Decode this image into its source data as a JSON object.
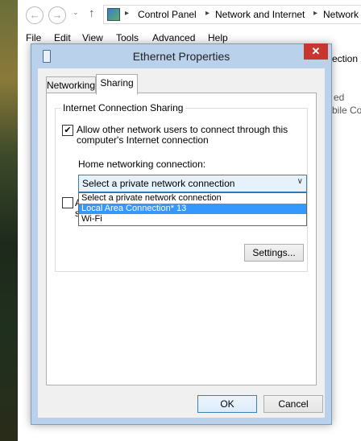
{
  "explorer": {
    "nav": {
      "back_icon": "←",
      "forward_icon": "→",
      "up_icon": "↑",
      "dropdown_icon": "⌄"
    },
    "breadcrumb": [
      "Control Panel",
      "Network and Internet",
      "Network"
    ],
    "breadcrumb_separator": "▸",
    "menu": [
      "File",
      "Edit",
      "View",
      "Tools",
      "Advanced",
      "Help"
    ],
    "right_fragments": [
      "ection",
      "ed",
      "bile Co"
    ]
  },
  "dialog": {
    "title": "Ethernet Properties",
    "close_glyph": "✕",
    "tabs": [
      {
        "label": "Networking"
      },
      {
        "label": "Sharing"
      }
    ],
    "group_title": "Internet Connection Sharing",
    "allow_checkbox": {
      "checked": true,
      "mark": "✔",
      "label_line1": "Allow other network users to connect through this",
      "label_line2": "computer's Internet connection"
    },
    "home_networking_label": "Home networking connection:",
    "combo": {
      "value": "Select a private network connection",
      "arrow": "∨"
    },
    "dropdown_options": [
      {
        "label": "Select a private network connection",
        "selected": false
      },
      {
        "label": "Local Area Connection* 13",
        "selected": true
      },
      {
        "label": "Wi-Fi",
        "selected": false
      }
    ],
    "second_checkbox": {
      "checked": false,
      "partial_label": "A",
      "partial_label2": "s"
    },
    "settings_button": "Settings...",
    "ok_button": "OK",
    "cancel_button": "Cancel"
  },
  "colors": {
    "dialog_frame": "#b9d1ea",
    "close_red": "#c7372f",
    "selection_blue": "#3399ff",
    "combo_border": "#3c7fb1"
  }
}
